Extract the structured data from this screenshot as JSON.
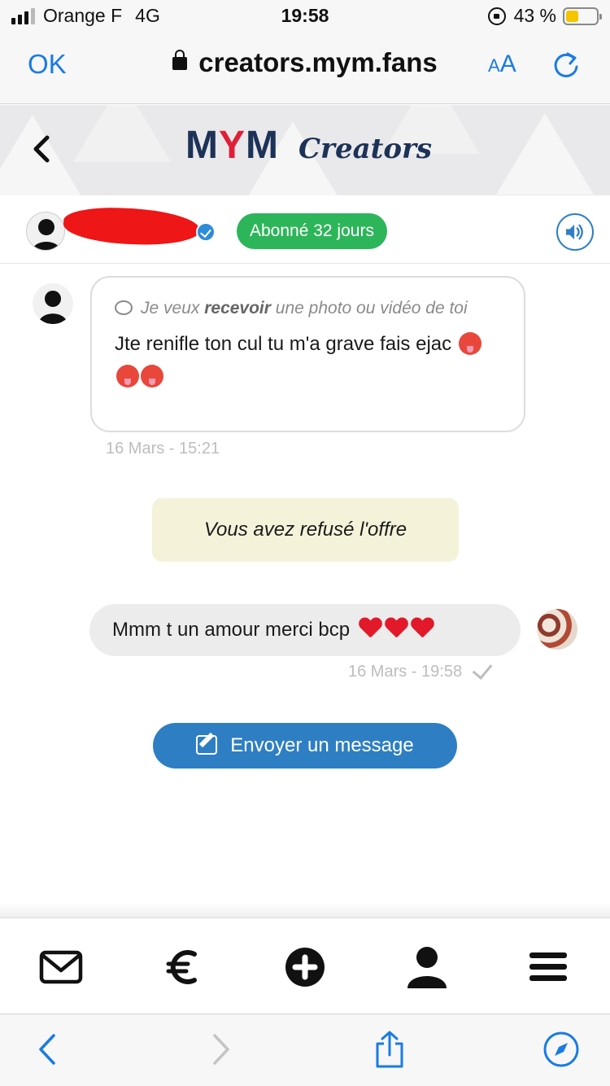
{
  "status_bar": {
    "carrier": "Orange F",
    "network": "4G",
    "time": "19:58",
    "battery_text": "43 %",
    "battery_level": 0.43,
    "signal_bars_active": 3
  },
  "browser": {
    "ok_label": "OK",
    "url": "creators.mym.fans",
    "text_size_small": "A",
    "text_size_large": "A"
  },
  "app_header": {
    "logo_m1": "M",
    "logo_y": "Y",
    "logo_m2": "M",
    "logo_creators": "Creators"
  },
  "conversation": {
    "subscription_badge": "Abonné 32 jours",
    "incoming": {
      "request_prefix": "Je veux ",
      "request_bold": "recevoir",
      "request_suffix": " une photo ou vidéo de toi",
      "text": "Jte renifle ton cul tu m'a grave fais ejac",
      "timestamp": "16 Mars - 15:21"
    },
    "system_notice": "Vous avez refusé l'offre",
    "outgoing": {
      "text": "Mmm t un amour merci bcp",
      "timestamp": "16 Mars - 19:58"
    },
    "send_button_label": "Envoyer un message"
  },
  "colors": {
    "accent_blue": "#2e7ec4",
    "ios_blue": "#1a7be3",
    "badge_green": "#2db55a",
    "logo_navy": "#1d3257",
    "logo_red": "#e01f37",
    "notice_bg": "#f4f3da"
  },
  "icons": {
    "app_nav": [
      "mail-icon",
      "euro-icon",
      "plus-circle-icon",
      "user-icon",
      "menu-icon"
    ],
    "browser_toolbar": [
      "back-arrow-icon",
      "forward-arrow-icon",
      "share-icon",
      "compass-icon"
    ]
  }
}
